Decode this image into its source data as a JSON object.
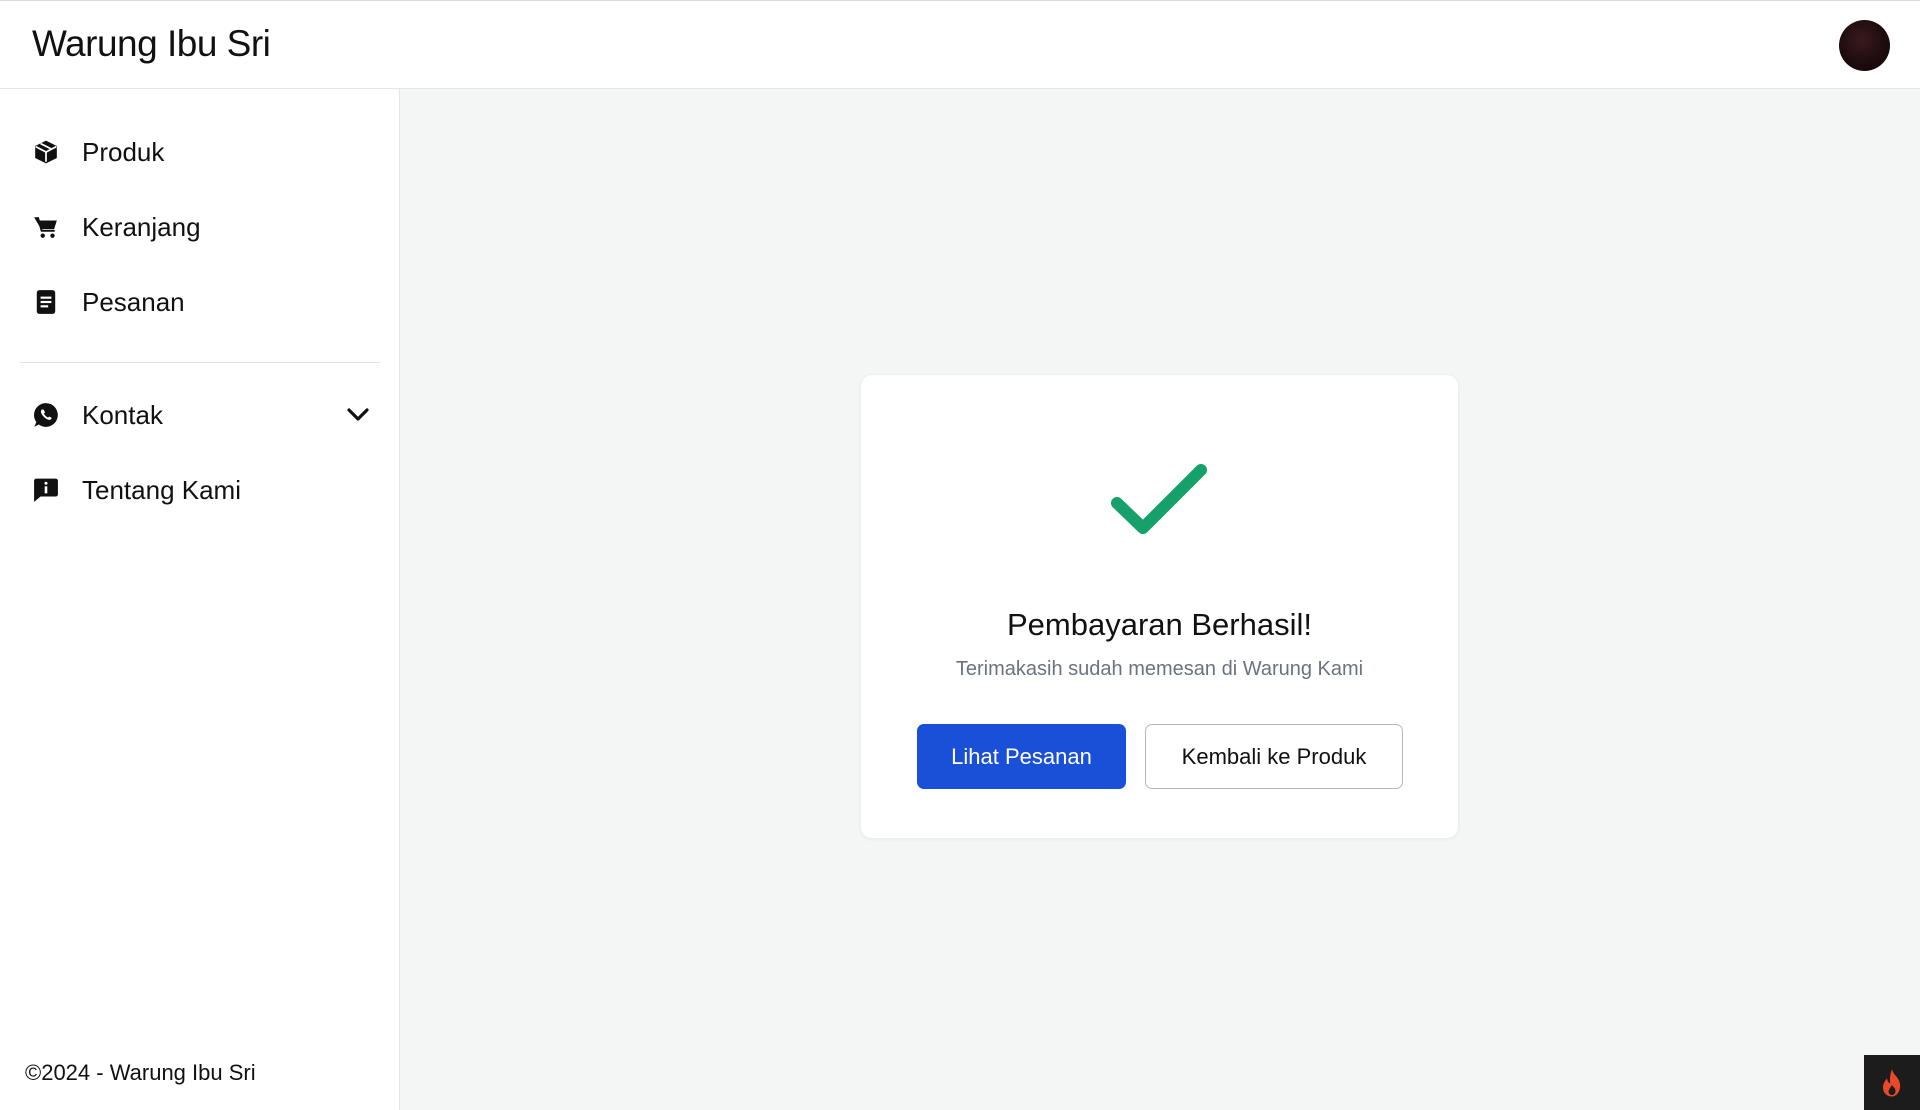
{
  "header": {
    "brand": "Warung Ibu Sri",
    "avatar_icon": "user-avatar"
  },
  "sidebar": {
    "items": [
      {
        "label": "Produk",
        "icon": "box-icon"
      },
      {
        "label": "Keranjang",
        "icon": "cart-icon"
      },
      {
        "label": "Pesanan",
        "icon": "document-icon"
      },
      {
        "label": "Kontak",
        "icon": "whatsapp-icon",
        "expandable": true
      },
      {
        "label": "Tentang Kami",
        "icon": "info-message-icon"
      }
    ],
    "footer": "©2024 - Warung Ibu Sri"
  },
  "main": {
    "card": {
      "icon": "checkmark-icon",
      "title": "Pembayaran Berhasil!",
      "subtitle": "Terimakasih sudah memesan di Warung Kami",
      "primary_button": "Lihat Pesanan",
      "secondary_button": "Kembali ke Produk"
    }
  },
  "colors": {
    "accent": "#1a4fd8",
    "success": "#16a06a",
    "main_bg": "#f4f5f5"
  }
}
